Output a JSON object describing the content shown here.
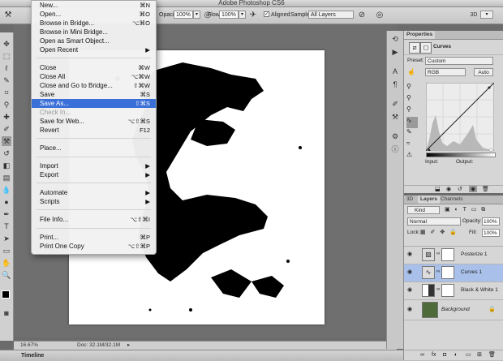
{
  "app": {
    "title": "Adobe Photoshop CS6"
  },
  "options_bar": {
    "opacity_label": "Opacity:",
    "opacity_value": "100%",
    "flow_label": "Flow:",
    "flow_value": "100%",
    "aligned_label": "Aligned",
    "sample_label": "Sample:",
    "sample_value": "All Layers"
  },
  "workspace": {
    "label": "3D"
  },
  "file_menu": [
    {
      "label": "New...",
      "shortcut": "⌘N"
    },
    {
      "label": "Open...",
      "shortcut": "⌘O"
    },
    {
      "label": "Browse in Bridge...",
      "shortcut": "⌥⌘O"
    },
    {
      "label": "Browse in Mini Bridge...",
      "shortcut": ""
    },
    {
      "label": "Open as Smart Object...",
      "shortcut": ""
    },
    {
      "label": "Open Recent",
      "shortcut": "▶"
    },
    {
      "label": "Close",
      "shortcut": "⌘W"
    },
    {
      "label": "Close All",
      "shortcut": "⌥⌘W"
    },
    {
      "label": "Close and Go to Bridge...",
      "shortcut": "⇧⌘W"
    },
    {
      "label": "Save",
      "shortcut": "⌘S"
    },
    {
      "label": "Save As...",
      "shortcut": "⇧⌘S"
    },
    {
      "label": "Check In...",
      "shortcut": ""
    },
    {
      "label": "Save for Web...",
      "shortcut": "⌥⇧⌘S"
    },
    {
      "label": "Revert",
      "shortcut": "F12"
    },
    {
      "label": "Place...",
      "shortcut": ""
    },
    {
      "label": "Import",
      "shortcut": "▶"
    },
    {
      "label": "Export",
      "shortcut": "▶"
    },
    {
      "label": "Automate",
      "shortcut": "▶"
    },
    {
      "label": "Scripts",
      "shortcut": "▶"
    },
    {
      "label": "File Info...",
      "shortcut": "⌥⇧⌘I"
    },
    {
      "label": "Print...",
      "shortcut": "⌘P"
    },
    {
      "label": "Print One Copy",
      "shortcut": "⌥⇧⌘P"
    }
  ],
  "status": {
    "zoom": "16.67%",
    "doc": "Doc: 32.1M/32.1M"
  },
  "timeline": {
    "label": "Timeline"
  },
  "properties": {
    "tab": "Properties",
    "type": "Curves",
    "preset_label": "Preset:",
    "preset_value": "Custom",
    "channel_value": "RGB",
    "auto_label": "Auto",
    "input_label": "Input:",
    "output_label": "Output:"
  },
  "layers_panel": {
    "tabs": [
      "3D",
      "Layers",
      "Channels"
    ],
    "kind_label": "Kind",
    "blend_mode": "Normal",
    "opacity_label": "Opacity:",
    "opacity_value": "100%",
    "lock_label": "Lock:",
    "fill_label": "Fill:",
    "fill_value": "100%",
    "layers": [
      {
        "name": "Posterize 1"
      },
      {
        "name": "Curves 1"
      },
      {
        "name": "Black & White 1"
      },
      {
        "name": "Background"
      }
    ]
  }
}
